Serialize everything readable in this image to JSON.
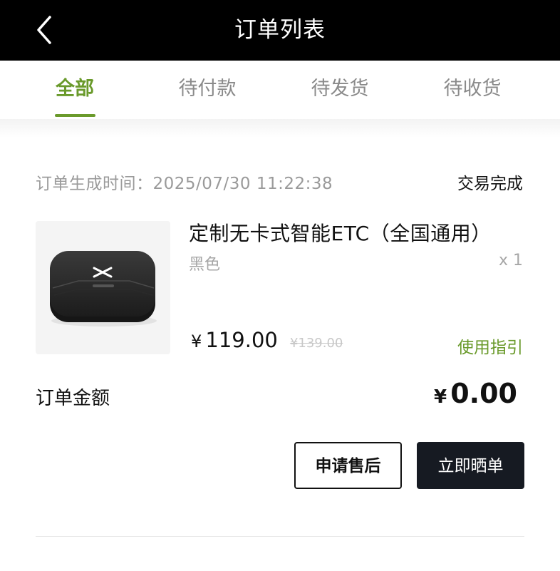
{
  "header": {
    "title": "订单列表",
    "back_icon": "chevron-left-icon"
  },
  "tabs": [
    {
      "label": "全部",
      "active": true
    },
    {
      "label": "待付款",
      "active": false
    },
    {
      "label": "待发货",
      "active": false
    },
    {
      "label": "待收货",
      "active": false
    }
  ],
  "colors": {
    "accent": "#6a9a2b",
    "header_bg": "#000000",
    "primary_button_bg": "#161a22"
  },
  "order": {
    "time_label": "订单生成时间：2025/07/30 11:22:38",
    "status": "交易完成",
    "product": {
      "image_icon": "etc-device-icon",
      "name": "定制无卡式智能ETC（全国通用）",
      "color": "黑色",
      "quantity": "x 1",
      "price_symbol": "¥",
      "price": "119.00",
      "original_price": "¥139.00",
      "guide_label": "使用指引"
    },
    "total_label": "订单金额",
    "total_symbol": "¥",
    "total_value": "0.00",
    "actions": {
      "aftersale_label": "申请售后",
      "review_label": "立即晒单"
    }
  }
}
